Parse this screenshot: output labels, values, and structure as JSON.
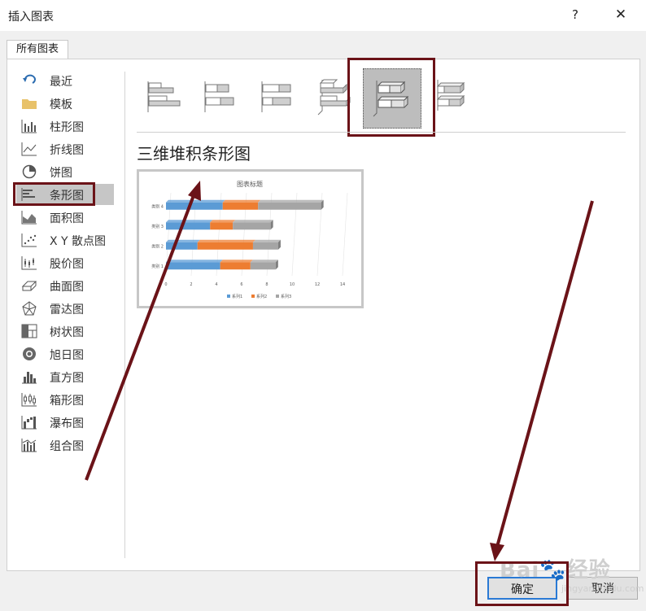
{
  "dialog": {
    "title": "插入图表",
    "help": "?",
    "close": "✕"
  },
  "tab": {
    "label": "所有图表"
  },
  "sidebar": {
    "items": [
      {
        "label": "最近",
        "icon": "undo-icon"
      },
      {
        "label": "模板",
        "icon": "folder-icon"
      },
      {
        "label": "柱形图",
        "icon": "column-chart-icon"
      },
      {
        "label": "折线图",
        "icon": "line-chart-icon"
      },
      {
        "label": "饼图",
        "icon": "pie-chart-icon"
      },
      {
        "label": "条形图",
        "icon": "bar-chart-icon"
      },
      {
        "label": "面积图",
        "icon": "area-chart-icon"
      },
      {
        "label": "X Y 散点图",
        "icon": "scatter-chart-icon"
      },
      {
        "label": "股价图",
        "icon": "stock-chart-icon"
      },
      {
        "label": "曲面图",
        "icon": "surface-chart-icon"
      },
      {
        "label": "雷达图",
        "icon": "radar-chart-icon"
      },
      {
        "label": "树状图",
        "icon": "treemap-chart-icon"
      },
      {
        "label": "旭日图",
        "icon": "sunburst-chart-icon"
      },
      {
        "label": "直方图",
        "icon": "histogram-chart-icon"
      },
      {
        "label": "箱形图",
        "icon": "box-whisker-chart-icon"
      },
      {
        "label": "瀑布图",
        "icon": "waterfall-chart-icon"
      },
      {
        "label": "组合图",
        "icon": "combo-chart-icon"
      }
    ],
    "selected_index": 5
  },
  "subtypes": {
    "names": [
      "clustered-bar",
      "stacked-bar",
      "100-stacked-bar",
      "3d-clustered-bar",
      "3d-stacked-bar",
      "3d-100-stacked-bar"
    ],
    "selected_index": 4
  },
  "chart_title": "三维堆积条形图",
  "chart_data": {
    "type": "bar",
    "title": "图表标题",
    "orientation": "horizontal",
    "stacked": true,
    "three_d": true,
    "categories": [
      "类别 1",
      "类别 2",
      "类别 3",
      "类别 4"
    ],
    "series": [
      {
        "name": "系列1",
        "values": [
          4.3,
          2.5,
          3.5,
          4.5
        ],
        "color": "#5b9bd5"
      },
      {
        "name": "系列2",
        "values": [
          2.4,
          4.4,
          1.8,
          2.8
        ],
        "color": "#ed7d31"
      },
      {
        "name": "系列3",
        "values": [
          2.0,
          2.0,
          3.0,
          5.0
        ],
        "color": "#a5a5a5"
      }
    ],
    "xlim": [
      0,
      14
    ],
    "xticks": [
      "0",
      "2",
      "4",
      "6",
      "8",
      "10",
      "12",
      "14"
    ],
    "legend": "bottom",
    "grid": true
  },
  "buttons": {
    "ok": "确定",
    "cancel": "取消"
  },
  "watermark": {
    "text": "Bai du经验",
    "url": "jingyan.baidu.com"
  },
  "colors": {
    "annotation": "#6b1318",
    "ok_border": "#2a7ad5"
  }
}
